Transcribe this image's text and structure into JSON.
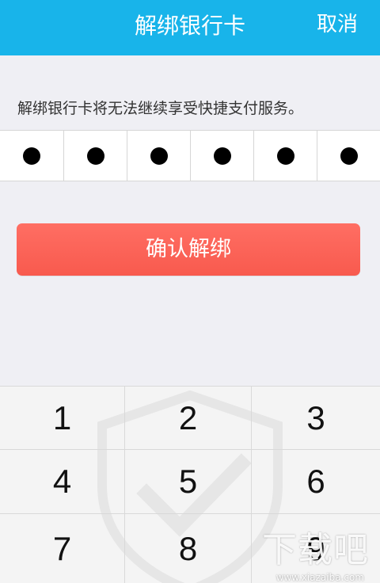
{
  "header": {
    "title": "解绑银行卡",
    "cancel_label": "取消"
  },
  "hint": "解绑银行卡将无法继续享受快捷支付服务。",
  "pin": {
    "length": 6,
    "filled": 6
  },
  "confirm_label": "确认解绑",
  "keypad": {
    "keys": [
      "1",
      "2",
      "3",
      "4",
      "5",
      "6",
      "7",
      "8",
      "9"
    ]
  },
  "watermark": {
    "main": "下载吧",
    "sub": "www.xiazaiba.com"
  },
  "colors": {
    "header": "#18b4ea",
    "button": "#f85a4e",
    "background": "#efeff4"
  }
}
